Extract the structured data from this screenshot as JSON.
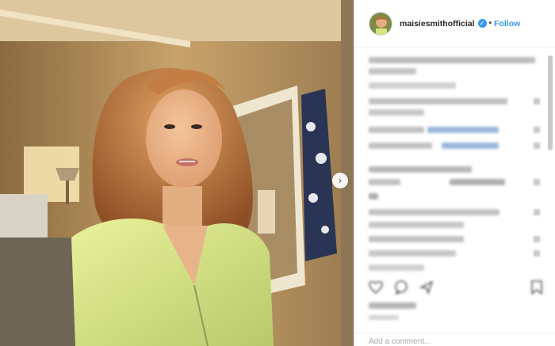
{
  "post": {
    "username": "maisiesmithofficial",
    "follow_label": "Follow",
    "separator": "•",
    "verified_glyph": "✓",
    "next_glyph": "›"
  },
  "comment_box": {
    "placeholder": "Add a comment..."
  },
  "icons": {
    "next": "chevron-right-icon",
    "verified": "verified-badge-icon",
    "like": "heart-icon",
    "comment": "comment-bubble-icon",
    "share": "share-icon",
    "save": "bookmark-icon"
  },
  "colors": {
    "accent": "#3897f0",
    "text": "#262626",
    "blurred_text": "#b9b9b9"
  }
}
